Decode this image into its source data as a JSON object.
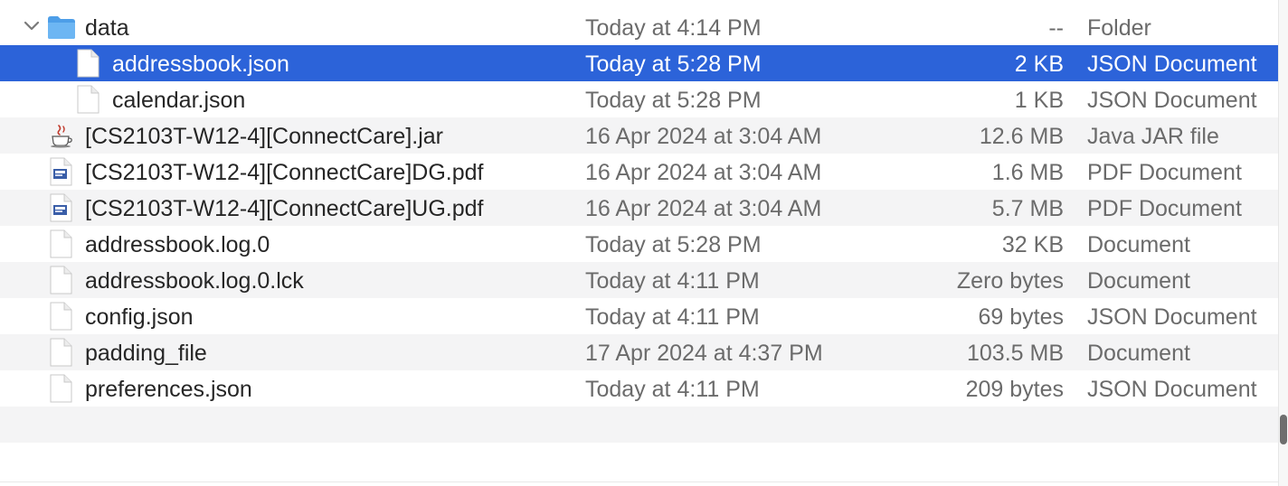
{
  "files": [
    {
      "name": "data",
      "date": "Today at 4:14 PM",
      "size": "--",
      "kind": "Folder",
      "icon": "folder-icon",
      "expanded": true
    },
    {
      "name": "addressbook.json",
      "date": "Today at 5:28 PM",
      "size": "2 KB",
      "kind": "JSON Document",
      "icon": "document-icon",
      "selected": true
    },
    {
      "name": "calendar.json",
      "date": "Today at 5:28 PM",
      "size": "1 KB",
      "kind": "JSON Document",
      "icon": "document-icon"
    },
    {
      "name": "[CS2103T-W12-4][ConnectCare].jar",
      "date": "16 Apr 2024 at 3:04 AM",
      "size": "12.6 MB",
      "kind": "Java JAR file",
      "icon": "java-jar-icon"
    },
    {
      "name": "[CS2103T-W12-4][ConnectCare]DG.pdf",
      "date": "16 Apr 2024 at 3:04 AM",
      "size": "1.6 MB",
      "kind": "PDF Document",
      "icon": "pdf-document-icon"
    },
    {
      "name": "[CS2103T-W12-4][ConnectCare]UG.pdf",
      "date": "16 Apr 2024 at 3:04 AM",
      "size": "5.7 MB",
      "kind": "PDF Document",
      "icon": "pdf-document-icon"
    },
    {
      "name": "addressbook.log.0",
      "date": "Today at 5:28 PM",
      "size": "32 KB",
      "kind": "Document",
      "icon": "document-icon"
    },
    {
      "name": "addressbook.log.0.lck",
      "date": "Today at 4:11 PM",
      "size": "Zero bytes",
      "kind": "Document",
      "icon": "document-icon"
    },
    {
      "name": "config.json",
      "date": "Today at 4:11 PM",
      "size": "69 bytes",
      "kind": "JSON Document",
      "icon": "document-icon"
    },
    {
      "name": "padding_file",
      "date": "17 Apr 2024 at 4:37 PM",
      "size": "103.5 MB",
      "kind": "Document",
      "icon": "document-icon"
    },
    {
      "name": "preferences.json",
      "date": "Today at 4:11 PM",
      "size": "209 bytes",
      "kind": "JSON Document",
      "icon": "document-icon"
    }
  ],
  "colors": {
    "selection": "#2c63d9",
    "alternate_row": "#f4f4f5",
    "folder_blue": "#5aa9ee"
  }
}
